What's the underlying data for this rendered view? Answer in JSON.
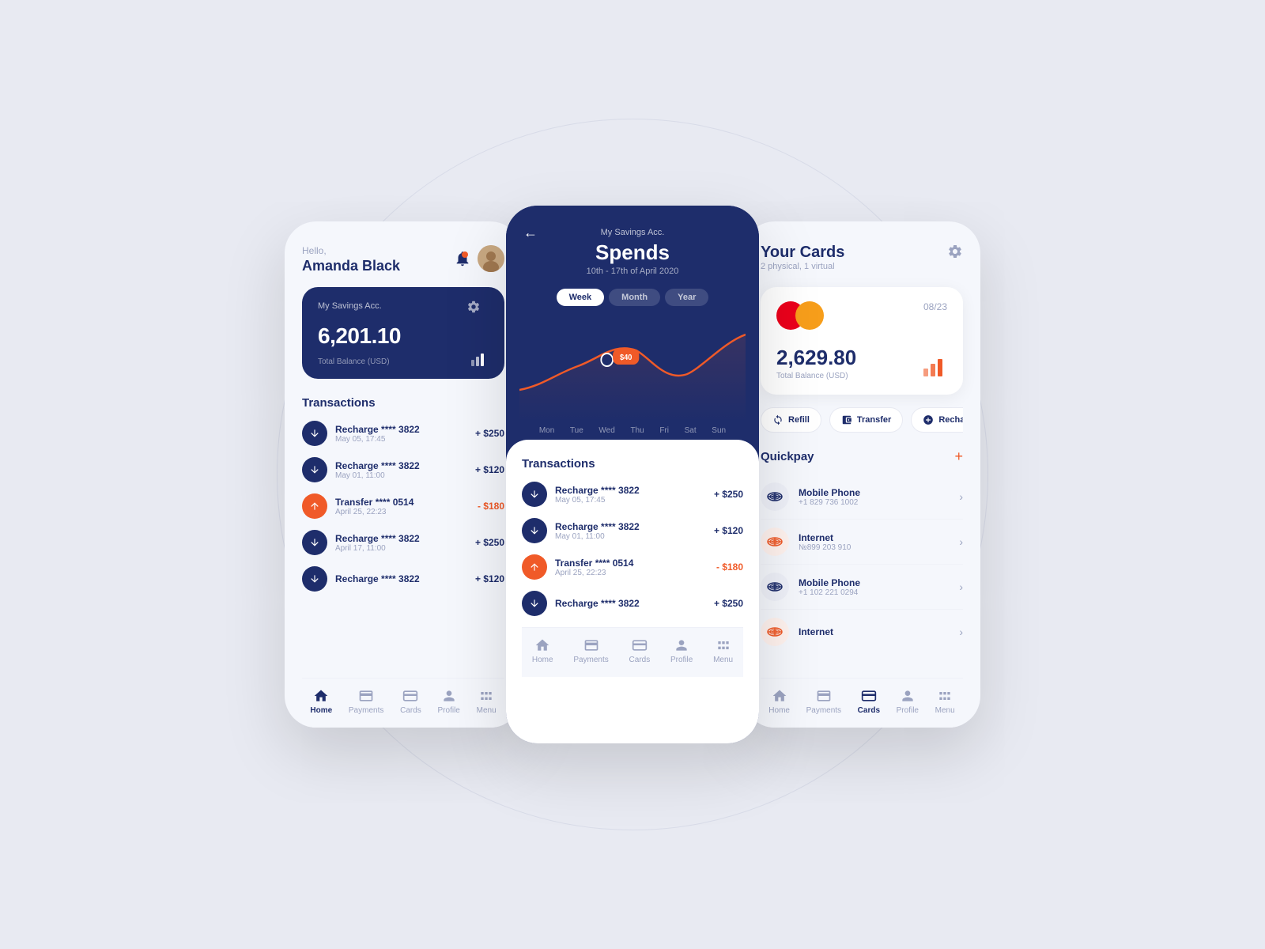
{
  "background": {
    "color": "#e8eaf2"
  },
  "phone_left": {
    "greeting": "Hello,",
    "user_name": "Amanda Black",
    "savings_card": {
      "label": "My Savings Acc.",
      "amount": "6,201.10",
      "balance_label": "Total Balance (USD)"
    },
    "transactions_title": "Transactions",
    "transactions": [
      {
        "name": "Recharge **** 3822",
        "date": "May 05, 17:45",
        "amount": "+ $250",
        "type": "in"
      },
      {
        "name": "Recharge **** 3822",
        "date": "May 01, 11:00",
        "amount": "+ $120",
        "type": "in"
      },
      {
        "name": "Transfer **** 0514",
        "date": "April 25, 22:23",
        "amount": "- $180",
        "type": "out"
      },
      {
        "name": "Recharge **** 3822",
        "date": "April 17, 11:00",
        "amount": "+ $250",
        "type": "in"
      },
      {
        "name": "Recharge **** 3822",
        "date": "",
        "amount": "+ $120",
        "type": "in"
      }
    ],
    "nav": [
      {
        "label": "Home",
        "active": true
      },
      {
        "label": "Payments",
        "active": false
      },
      {
        "label": "Cards",
        "active": false
      },
      {
        "label": "Profile",
        "active": false
      },
      {
        "label": "Menu",
        "active": false
      }
    ]
  },
  "phone_center": {
    "back_label": "←",
    "acc_label": "My Savings Acc.",
    "title": "Spends",
    "date_range": "10th - 17th of April 2020",
    "period_tabs": [
      {
        "label": "Week",
        "active": true
      },
      {
        "label": "Month",
        "active": false
      },
      {
        "label": "Year",
        "active": false
      }
    ],
    "chart_tooltip": "$40",
    "days": [
      "Mon",
      "Tue",
      "Wed",
      "Thu",
      "Fri",
      "Sat",
      "Sun"
    ],
    "transactions_title": "Transactions",
    "transactions": [
      {
        "name": "Recharge **** 3822",
        "date": "May 05, 17:45",
        "amount": "+ $250",
        "type": "in"
      },
      {
        "name": "Recharge **** 3822",
        "date": "May 01, 11:00",
        "amount": "+ $120",
        "type": "in"
      },
      {
        "name": "Transfer **** 0514",
        "date": "April 25, 22:23",
        "amount": "- $180",
        "type": "out"
      },
      {
        "name": "Recharge **** 3822",
        "date": "",
        "amount": "+ $250",
        "type": "in"
      }
    ],
    "nav": [
      {
        "label": "Home",
        "active": false
      },
      {
        "label": "Payments",
        "active": false
      },
      {
        "label": "Cards",
        "active": false
      },
      {
        "label": "Profile",
        "active": false
      },
      {
        "label": "Menu",
        "active": false
      }
    ]
  },
  "phone_right": {
    "title": "Your Cards",
    "subtitle": "2 physical, 1 virtual",
    "card": {
      "expiry": "08/23",
      "amount": "2,629.80",
      "balance_label": "Total Balance (USD)"
    },
    "action_buttons": [
      "Refill",
      "Transfer",
      "Recharge"
    ],
    "quickpay_title": "Quickpay",
    "quickpay_items": [
      {
        "name": "Mobile Phone",
        "number": "+1 829 736 1002",
        "color": "#1e2d6b"
      },
      {
        "name": "Internet",
        "number": "№899 203 910",
        "color": "#f05a28"
      },
      {
        "name": "Mobile Phone",
        "number": "+1 102 221 0294",
        "color": "#1e2d6b"
      },
      {
        "name": "Internet",
        "number": "",
        "color": "#f05a28"
      }
    ],
    "nav": [
      {
        "label": "Home",
        "active": false
      },
      {
        "label": "Payments",
        "active": false
      },
      {
        "label": "Cards",
        "active": true
      },
      {
        "label": "Profile",
        "active": false
      },
      {
        "label": "Menu",
        "active": false
      }
    ]
  }
}
